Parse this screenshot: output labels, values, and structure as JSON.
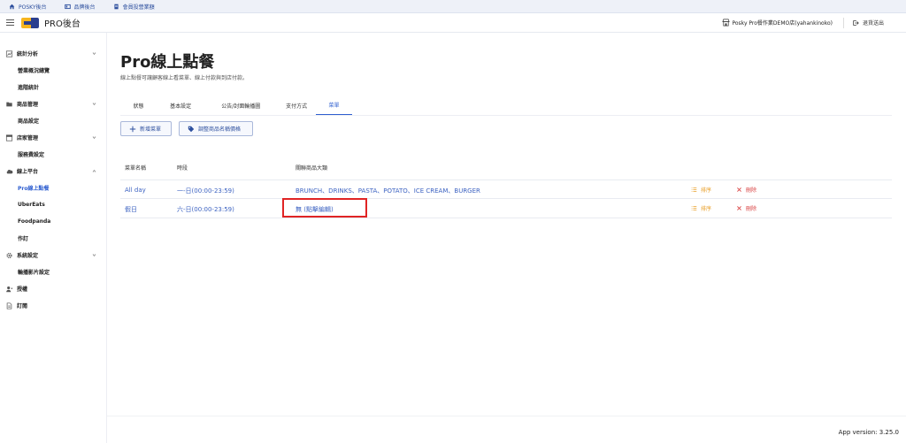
{
  "topbar": {
    "items": [
      {
        "label": "POSKY後台",
        "icon": "home-icon"
      },
      {
        "label": "品牌後台",
        "icon": "dashboard-icon"
      },
      {
        "label": "會員投營業額",
        "icon": "document-icon"
      }
    ]
  },
  "header": {
    "brand": "PRO後台",
    "store": "Posky Pro餐作業DEMO店(yahankinoko)",
    "logout": "退貨送出"
  },
  "sidebar": {
    "items": [
      {
        "label": "統計分析",
        "type": "group",
        "icon": "chart-icon"
      },
      {
        "label": "營業概況總覽",
        "type": "sub"
      },
      {
        "label": "進階統計",
        "type": "sub"
      },
      {
        "label": "商品管理",
        "type": "group",
        "icon": "folder-icon"
      },
      {
        "label": "商品設定",
        "type": "sub"
      },
      {
        "label": "店家管理",
        "type": "group",
        "icon": "store-icon"
      },
      {
        "label": "服務費設定",
        "type": "sub"
      },
      {
        "label": "線上平台",
        "type": "group",
        "icon": "cloud-icon"
      },
      {
        "label": "Pro線上點餐",
        "type": "sub",
        "active": true
      },
      {
        "label": "UberEats",
        "type": "sub"
      },
      {
        "label": "Foodpanda",
        "type": "sub"
      },
      {
        "label": "作訂",
        "type": "sub"
      },
      {
        "label": "系統設定",
        "type": "group",
        "icon": "gear-icon"
      },
      {
        "label": "輪播影片設定",
        "type": "sub"
      },
      {
        "label": "授權",
        "type": "group",
        "icon": "user-icon"
      },
      {
        "label": "訂閱",
        "type": "group",
        "icon": "file-icon"
      }
    ]
  },
  "main": {
    "title": "Pro線上點餐",
    "subtitle": "線上點餐可讓顧客線上看菜單、線上付款與到店付款。",
    "tabs": [
      "狀態",
      "基本設定",
      "公告/封面輪播圖",
      "支付方式",
      "菜單"
    ],
    "active_tab": 4,
    "buttons": {
      "add_menu": "新增菜單",
      "adjust_price": "調整商品名稱價格"
    },
    "table": {
      "headers": [
        "菜單名稱",
        "時段",
        "關聯商品大類"
      ],
      "rows": [
        {
          "name": "All day",
          "period": "一-日(00:00-23:59)",
          "categories": "BRUNCH、DRINKS、PASTA、POTATO、ICE CREAM、BURGER",
          "sort": "排序",
          "delete": "刪除"
        },
        {
          "name": "假日",
          "period": "六-日(00:00-23:59)",
          "categories": "無 (點擊編輯)",
          "sort": "排序",
          "delete": "刪除"
        }
      ]
    },
    "version": "App version: 3.25.0"
  },
  "colors": {
    "accent": "#2f5fd0",
    "sort": "#e9a02a",
    "delete": "#d94242",
    "highlight": "#e02424"
  }
}
